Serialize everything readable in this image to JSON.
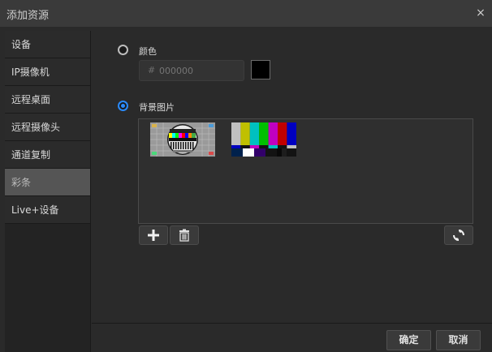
{
  "window": {
    "title": "添加资源",
    "close_glyph": "×"
  },
  "sidebar": {
    "items": [
      {
        "label": "设备",
        "active": false
      },
      {
        "label": "IP摄像机",
        "active": false
      },
      {
        "label": "远程桌面",
        "active": false
      },
      {
        "label": "远程摄像头",
        "active": false
      },
      {
        "label": "通道复制",
        "active": false
      },
      {
        "label": "彩条",
        "active": true
      },
      {
        "label": "Live+设备",
        "active": false
      }
    ]
  },
  "color_option": {
    "label": "颜色",
    "hash": "#",
    "placeholder": "000000",
    "swatch_color": "#000000",
    "selected": false
  },
  "image_option": {
    "label": "背景图片",
    "selected": true
  },
  "images": [
    {
      "name": "test-card-pattern"
    },
    {
      "name": "color-bars"
    }
  ],
  "toolbar": {
    "add_icon": "plus-icon",
    "delete_icon": "trash-icon",
    "refresh_icon": "refresh-icon"
  },
  "footer": {
    "ok_label": "确定",
    "cancel_label": "取消"
  },
  "colors": {
    "accent": "#2a8bff",
    "active_sidebar": "#555555"
  }
}
